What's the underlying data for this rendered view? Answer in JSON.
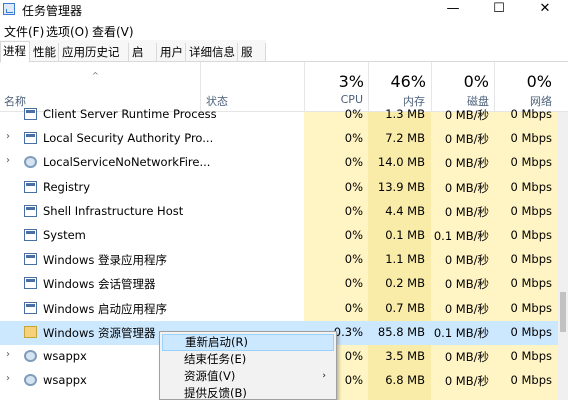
{
  "window": {
    "title": "任务管理器",
    "minimize_glyph": "—",
    "maximize_glyph": "☐",
    "close_glyph": "✕"
  },
  "menu": [
    "文件(F)",
    "选项(O)",
    "查看(V)"
  ],
  "tabs": [
    "进程",
    "性能",
    "应用历史记录",
    "启动",
    "用户",
    "详细信息",
    "服务"
  ],
  "columns": {
    "name": "名称",
    "status": "状态",
    "cpu": {
      "pct": "3%",
      "label": "CPU"
    },
    "memory": {
      "pct": "46%",
      "label": "内存"
    },
    "disk": {
      "pct": "0%",
      "label": "磁盘"
    },
    "network": {
      "pct": "0%",
      "label": "网络"
    }
  },
  "rows": [
    {
      "name": "Client Server Runtime Process",
      "cpu": "0%",
      "memory": "1.3 MB",
      "disk": "0 MB/秒",
      "network": "0 Mbps",
      "icon": "app-icon",
      "expandable": false
    },
    {
      "name": "Local Security Authority Pro...",
      "cpu": "0%",
      "memory": "7.2 MB",
      "disk": "0 MB/秒",
      "network": "0 Mbps",
      "icon": "app-icon",
      "expandable": true
    },
    {
      "name": "LocalServiceNoNetworkFire...",
      "cpu": "0%",
      "memory": "14.0 MB",
      "disk": "0 MB/秒",
      "network": "0 Mbps",
      "icon": "gear-icon",
      "expandable": true
    },
    {
      "name": "Registry",
      "cpu": "0%",
      "memory": "13.9 MB",
      "disk": "0 MB/秒",
      "network": "0 Mbps",
      "icon": "app-icon",
      "expandable": false
    },
    {
      "name": "Shell Infrastructure Host",
      "cpu": "0%",
      "memory": "4.4 MB",
      "disk": "0 MB/秒",
      "network": "0 Mbps",
      "icon": "app-icon",
      "expandable": false
    },
    {
      "name": "System",
      "cpu": "0%",
      "memory": "0.1 MB",
      "disk": "0.1 MB/秒",
      "network": "0 Mbps",
      "icon": "app-icon",
      "expandable": false
    },
    {
      "name": "Windows 登录应用程序",
      "cpu": "0%",
      "memory": "1.1 MB",
      "disk": "0 MB/秒",
      "network": "0 Mbps",
      "icon": "app-icon",
      "expandable": false
    },
    {
      "name": "Windows 会话管理器",
      "cpu": "0%",
      "memory": "0.2 MB",
      "disk": "0 MB/秒",
      "network": "0 Mbps",
      "icon": "app-icon",
      "expandable": false
    },
    {
      "name": "Windows 启动应用程序",
      "cpu": "0%",
      "memory": "0.7 MB",
      "disk": "0 MB/秒",
      "network": "0 Mbps",
      "icon": "app-icon",
      "expandable": false
    },
    {
      "name": "Windows 资源管理器",
      "cpu": "0.3%",
      "memory": "85.8 MB",
      "disk": "0.1 MB/秒",
      "network": "0 Mbps",
      "icon": "folder-icon",
      "expandable": false,
      "selected": true
    },
    {
      "name": "wsappx",
      "cpu": "0%",
      "memory": "3.5 MB",
      "disk": "0 MB/秒",
      "network": "0 Mbps",
      "icon": "gear-icon",
      "expandable": true
    },
    {
      "name": "wsappx",
      "cpu": "0%",
      "memory": "6.8 MB",
      "disk": "0 MB/秒",
      "network": "0 Mbps",
      "icon": "gear-icon",
      "expandable": true
    }
  ],
  "context_menu": [
    {
      "label": "重新启动(R)",
      "highlighted": true,
      "submenu": false
    },
    {
      "label": "结束任务(E)",
      "highlighted": false,
      "submenu": false
    },
    {
      "label": "资源值(V)",
      "highlighted": false,
      "submenu": true
    },
    {
      "label": "提供反馈(B)",
      "highlighted": false,
      "submenu": false
    }
  ],
  "colors": {
    "heat_light": "#fff4c4",
    "heat_medium": "#f9eca8",
    "selection": "#cce8ff",
    "header_label": "#4c607a"
  }
}
